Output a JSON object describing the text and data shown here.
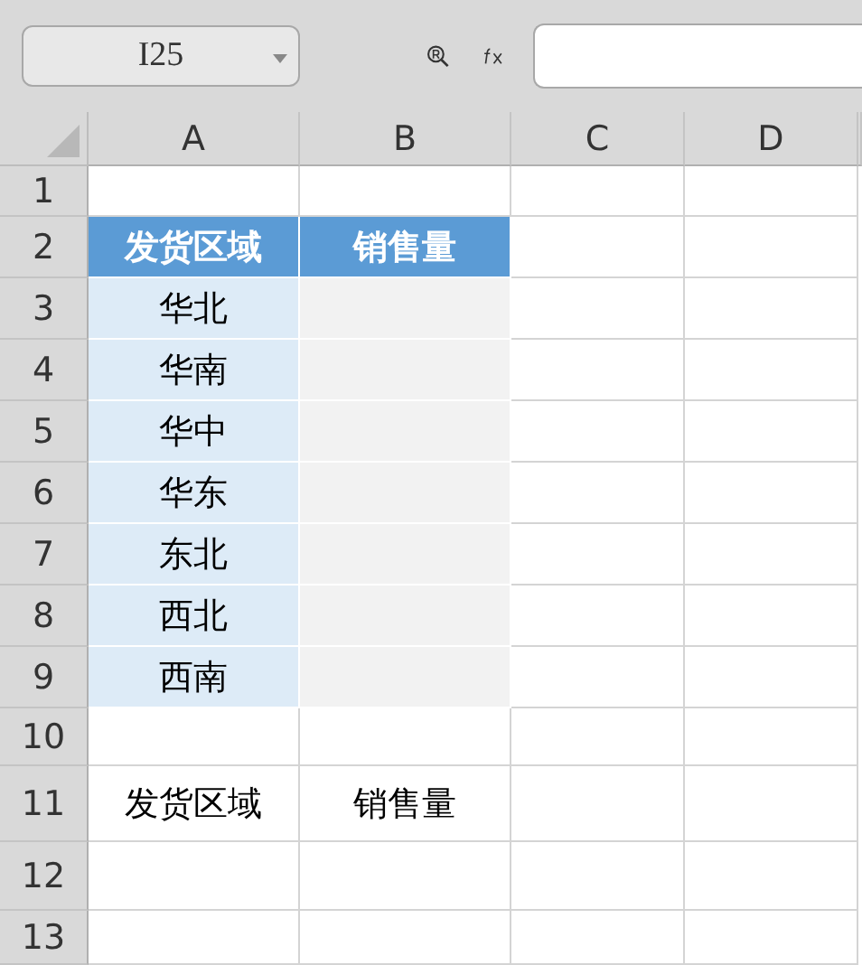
{
  "name_box": {
    "value": "I25"
  },
  "columns": [
    "A",
    "B",
    "C",
    "D"
  ],
  "rows": [
    {
      "number": "1",
      "cells": [
        {
          "kind": "plain",
          "text": ""
        },
        {
          "kind": "plain",
          "text": ""
        }
      ]
    },
    {
      "number": "2",
      "cells": [
        {
          "kind": "header",
          "text": "发货区域"
        },
        {
          "kind": "header",
          "text": "销售量"
        }
      ]
    },
    {
      "number": "3",
      "cells": [
        {
          "kind": "region",
          "text": "华北"
        },
        {
          "kind": "value",
          "text": ""
        }
      ]
    },
    {
      "number": "4",
      "cells": [
        {
          "kind": "region",
          "text": "华南"
        },
        {
          "kind": "value",
          "text": ""
        }
      ]
    },
    {
      "number": "5",
      "cells": [
        {
          "kind": "region",
          "text": "华中"
        },
        {
          "kind": "value",
          "text": ""
        }
      ]
    },
    {
      "number": "6",
      "cells": [
        {
          "kind": "region",
          "text": "华东"
        },
        {
          "kind": "value",
          "text": ""
        }
      ]
    },
    {
      "number": "7",
      "cells": [
        {
          "kind": "region",
          "text": "东北"
        },
        {
          "kind": "value",
          "text": ""
        }
      ]
    },
    {
      "number": "8",
      "cells": [
        {
          "kind": "region",
          "text": "西北"
        },
        {
          "kind": "value",
          "text": ""
        }
      ]
    },
    {
      "number": "9",
      "cells": [
        {
          "kind": "region",
          "text": "西南"
        },
        {
          "kind": "value",
          "text": ""
        }
      ]
    },
    {
      "number": "10",
      "cells": [
        {
          "kind": "plain",
          "text": ""
        },
        {
          "kind": "plain",
          "text": ""
        }
      ]
    },
    {
      "number": "11",
      "cells": [
        {
          "kind": "plain",
          "text": "发货区域"
        },
        {
          "kind": "plain",
          "text": "销售量"
        }
      ]
    },
    {
      "number": "12",
      "cells": [
        {
          "kind": "plain",
          "text": ""
        },
        {
          "kind": "plain",
          "text": ""
        }
      ]
    },
    {
      "number": "13",
      "cells": [
        {
          "kind": "plain",
          "text": ""
        },
        {
          "kind": "plain",
          "text": ""
        }
      ]
    }
  ]
}
